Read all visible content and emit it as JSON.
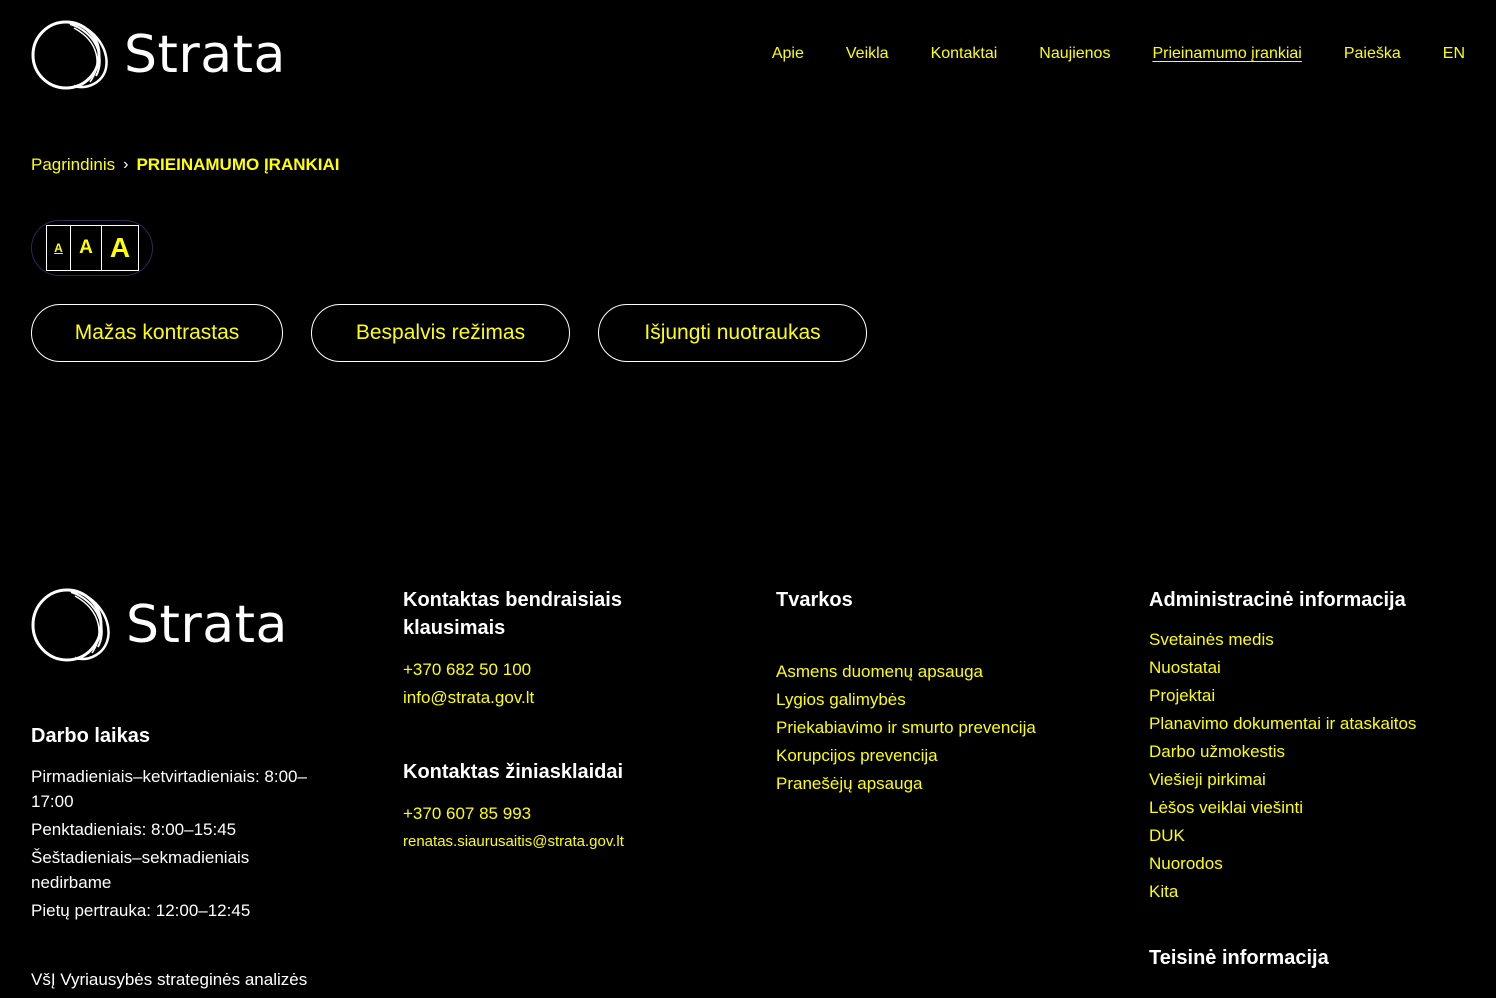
{
  "header": {
    "logo_text": "Strata",
    "nav": [
      {
        "label": "Apie"
      },
      {
        "label": "Veikla"
      },
      {
        "label": "Kontaktai"
      },
      {
        "label": "Naujienos"
      },
      {
        "label": "Prieinamumo įrankiai",
        "active": true
      },
      {
        "label": "Paieška"
      },
      {
        "label": "EN"
      }
    ]
  },
  "breadcrumb": {
    "home": "Pagrindinis",
    "separator": "›",
    "current": "PRIEINAMUMO ĮRANKIAI"
  },
  "font_size": {
    "small": "A",
    "medium": "A",
    "large": "A"
  },
  "modes": {
    "low_contrast": "Mažas kontrastas",
    "grayscale": "Bespalvis režimas",
    "disable_images": "Išjungti nuotraukas"
  },
  "colors": {
    "background": "#000000",
    "accent": "#ffff00",
    "text": "#ffffff"
  },
  "footer": {
    "logo_text": "Strata",
    "hours": {
      "title": "Darbo laikas",
      "lines": [
        "Pirmadieniais–ketvirtadieniais: 8:00–17:00",
        "Penktadieniais: 8:00–15:45",
        "Šeštadieniais–sekmadieniais nedirbame",
        "Pietų pertrauka: 12:00–12:45"
      ],
      "org": "VšĮ Vyriausybės strateginės analizės"
    },
    "contact_general": {
      "title": "Kontaktas bendraisiais klausimais",
      "phone": "+370 682 50 100",
      "email": "info@strata.gov.lt"
    },
    "contact_media": {
      "title": "Kontaktas žiniasklaidai",
      "phone": "+370 607 85 993",
      "email": "renatas.siaurusaitis@strata.gov.lt"
    },
    "policies": {
      "title": "Tvarkos",
      "items": [
        "Asmens duomenų apsauga",
        "Lygios galimybės",
        "Priekabiavimo ir smurto prevencija",
        "Korupcijos prevencija",
        "Pranešėjų apsauga"
      ]
    },
    "admin": {
      "title": "Administracinė informacija",
      "items": [
        "Svetainės medis",
        "Nuostatai",
        "Projektai",
        "Planavimo dokumentai ir ataskaitos",
        "Darbo užmokestis",
        "Viešieji pirkimai",
        "Lėšos veiklai viešinti",
        "DUK",
        "Nuorodos",
        "Kita"
      ],
      "legal_title": "Teisinė informacija"
    }
  }
}
